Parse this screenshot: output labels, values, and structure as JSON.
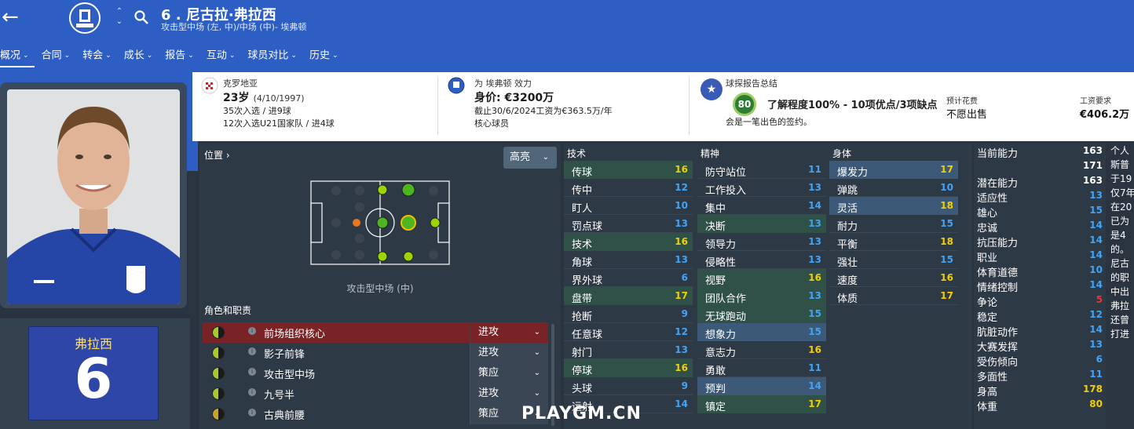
{
  "header": {
    "back_icon": "arrow-left-icon",
    "player_title": "6 . 尼古拉·弗拉西",
    "player_subtitle": "攻击型中场 (左, 中)/中场 (中)- 埃弗顿",
    "club_crest_icon": "everton-crest-icon",
    "search_icon": "search-icon",
    "accent": "#2c5ec4",
    "tabs": [
      {
        "label": "概况"
      },
      {
        "label": "合同"
      },
      {
        "label": "转会"
      },
      {
        "label": "成长"
      },
      {
        "label": "报告"
      },
      {
        "label": "互动"
      },
      {
        "label": "球员对比"
      },
      {
        "label": "历史"
      }
    ]
  },
  "info": {
    "nation": "克罗地亚",
    "age": "23岁",
    "birth": "(4/10/1997)",
    "caps": "35次入选 / 进9球",
    "u21": "12次入选U21国家队 / 进4球",
    "club_line": "为 埃弗顿 效力",
    "value": "身价: €3200万",
    "contract": "截止30/6/2024工资为€363.5万/年",
    "squad_status": "核心球员",
    "scout_title": "球探报告总结",
    "scout_score": "80",
    "scout_summary": "了解程度100% - 10项优点/3项缺点",
    "scout_comment": "会是一笔出色的签约。",
    "asking_label": "预计花费",
    "asking_value": "不愿出售",
    "wage_label": "工资要求",
    "wage_value": "€406.2万"
  },
  "shirt": {
    "name": "弗拉西",
    "number": "6"
  },
  "pitch": {
    "section_label": "位置 ›",
    "highlight_label": "高亮",
    "caption": "攻击型中场 (中)"
  },
  "roles": {
    "label": "角色和职责",
    "items": [
      {
        "name": "前场组织核心",
        "duty": "进攻"
      },
      {
        "name": "影子前锋",
        "duty": "进攻"
      },
      {
        "name": "攻击型中场",
        "duty": "策应"
      },
      {
        "name": "九号半",
        "duty": "进攻"
      },
      {
        "name": "古典前腰",
        "duty": "策应"
      }
    ]
  },
  "attributes": {
    "technical": {
      "title": "技术",
      "rows": [
        {
          "n": "传球",
          "v": "16",
          "hl": "g"
        },
        {
          "n": "传中",
          "v": "12"
        },
        {
          "n": "盯人",
          "v": "10"
        },
        {
          "n": "罚点球",
          "v": "13"
        },
        {
          "n": "技术",
          "v": "16",
          "hl": "g"
        },
        {
          "n": "角球",
          "v": "13"
        },
        {
          "n": "界外球",
          "v": "6"
        },
        {
          "n": "盘带",
          "v": "17",
          "hl": "g"
        },
        {
          "n": "抢断",
          "v": "9"
        },
        {
          "n": "任意球",
          "v": "12"
        },
        {
          "n": "射门",
          "v": "13"
        },
        {
          "n": "停球",
          "v": "16",
          "hl": "g"
        },
        {
          "n": "头球",
          "v": "9"
        },
        {
          "n": "远射",
          "v": "14"
        }
      ]
    },
    "mental": {
      "title": "精神",
      "rows": [
        {
          "n": "防守站位",
          "v": "11"
        },
        {
          "n": "工作投入",
          "v": "13"
        },
        {
          "n": "集中",
          "v": "14"
        },
        {
          "n": "决断",
          "v": "13",
          "hl": "g"
        },
        {
          "n": "领导力",
          "v": "13"
        },
        {
          "n": "侵略性",
          "v": "13"
        },
        {
          "n": "视野",
          "v": "16",
          "hl": "g"
        },
        {
          "n": "团队合作",
          "v": "13",
          "hl": "g"
        },
        {
          "n": "无球跑动",
          "v": "15",
          "hl": "g"
        },
        {
          "n": "想象力",
          "v": "15",
          "hl": "b"
        },
        {
          "n": "意志力",
          "v": "16"
        },
        {
          "n": "勇敢",
          "v": "11"
        },
        {
          "n": "预判",
          "v": "14",
          "hl": "b"
        },
        {
          "n": "镇定",
          "v": "17",
          "hl": "g"
        }
      ]
    },
    "physical": {
      "title": "身体",
      "rows": [
        {
          "n": "爆发力",
          "v": "17",
          "hl": "b"
        },
        {
          "n": "弹跳",
          "v": "10"
        },
        {
          "n": "灵活",
          "v": "18",
          "hl": "b"
        },
        {
          "n": "耐力",
          "v": "15"
        },
        {
          "n": "平衡",
          "v": "18"
        },
        {
          "n": "强壮",
          "v": "15"
        },
        {
          "n": "速度",
          "v": "16"
        },
        {
          "n": "体质",
          "v": "17"
        }
      ]
    }
  },
  "ability": {
    "rows": [
      {
        "n": "当前能力",
        "v": "163"
      },
      {
        "n": "",
        "v": "171"
      },
      {
        "n": "潜在能力",
        "v": "163"
      },
      {
        "n": "适应性",
        "v": "13"
      },
      {
        "n": "雄心",
        "v": "15"
      },
      {
        "n": "忠诚",
        "v": "14"
      },
      {
        "n": "抗压能力",
        "v": "14"
      },
      {
        "n": "职业",
        "v": "14"
      },
      {
        "n": "体育道德",
        "v": "10"
      },
      {
        "n": "情绪控制",
        "v": "14"
      },
      {
        "n": "争论",
        "v": "5",
        "c": "red"
      },
      {
        "n": "稳定",
        "v": "12"
      },
      {
        "n": "肮脏动作",
        "v": "14"
      },
      {
        "n": "大赛发挥",
        "v": "13"
      },
      {
        "n": "受伤倾向",
        "v": "6"
      },
      {
        "n": "多面性",
        "v": "11"
      },
      {
        "n": "身高",
        "v": "178",
        "c": "yel"
      },
      {
        "n": "体重",
        "v": "80",
        "c": "yel"
      }
    ]
  },
  "bio": {
    "lines": [
      "个人",
      "斯普",
      "于19",
      "仅7年",
      "在20",
      "已为",
      "是4",
      "的。",
      "",
      "尼古",
      "的职",
      "中出",
      "弗拉",
      "还曾",
      "打进"
    ]
  },
  "watermark": "PLAYGM.CN"
}
